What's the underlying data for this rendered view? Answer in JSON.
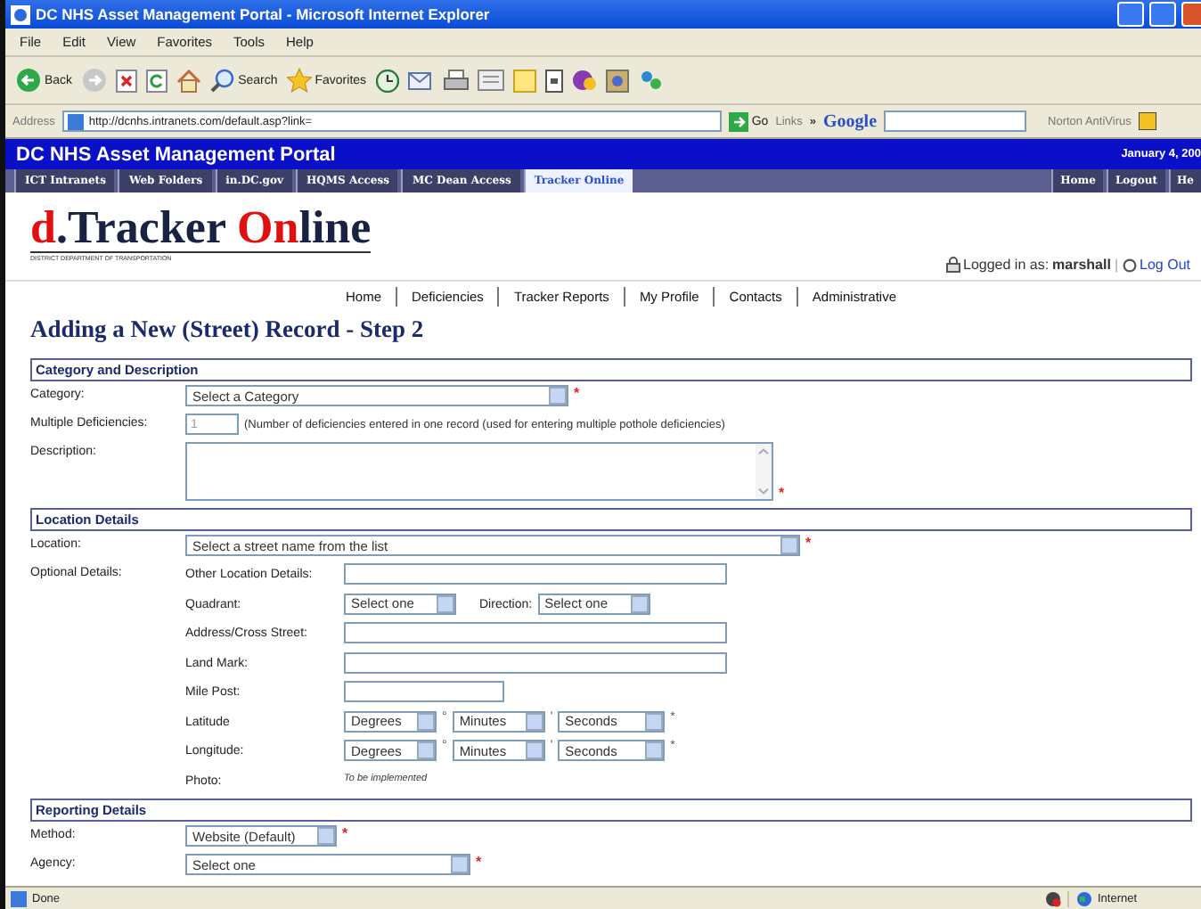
{
  "window": {
    "title": "DC NHS Asset Management Portal - Microsoft Internet Explorer"
  },
  "menu_bar": [
    "File",
    "Edit",
    "View",
    "Favorites",
    "Tools",
    "Help"
  ],
  "toolbar": [
    {
      "kind": "back",
      "label": "Back"
    },
    {
      "kind": "forward"
    },
    {
      "kind": "stop"
    },
    {
      "kind": "refresh"
    },
    {
      "kind": "home"
    },
    {
      "kind": "search",
      "label": "Search"
    },
    {
      "kind": "favorites",
      "label": "Favorites"
    },
    {
      "kind": "history"
    },
    {
      "kind": "mail"
    },
    {
      "kind": "print"
    },
    {
      "kind": "edit"
    },
    {
      "kind": "note"
    },
    {
      "kind": "phone"
    },
    {
      "kind": "messenger"
    },
    {
      "kind": "media"
    },
    {
      "kind": "people"
    }
  ],
  "address_bar": {
    "label": "Address",
    "value": "http://dcnhs.intranets.com/default.asp?link=",
    "go": "Go",
    "links": "Links",
    "links_more": "»",
    "search_brand": "Google",
    "norton": "Norton AntiVirus"
  },
  "portal": {
    "title": "DC NHS Asset Management Portal",
    "date": "January 4, 200",
    "tabs": [
      {
        "label": "ICT Intranets",
        "selected": false
      },
      {
        "label": "Web Folders",
        "selected": false
      },
      {
        "label": "in.DC.gov",
        "selected": false
      },
      {
        "label": "HQMS Access",
        "selected": false
      },
      {
        "label": "MC Dean Access",
        "selected": false
      },
      {
        "label": "Tracker Online",
        "selected": true
      }
    ],
    "right_links": [
      "Home",
      "Logout",
      "He"
    ]
  },
  "logo": {
    "parts": [
      {
        "text": "d",
        "accent": true
      },
      {
        "text": ".Tracker ",
        "accent": false
      },
      {
        "text": "On",
        "accent": true
      },
      {
        "text": "line",
        "accent": false
      }
    ],
    "tagline": "DISTRICT DEPARTMENT OF TRANSPORTATION"
  },
  "user": {
    "label": "Logged in as:",
    "name": "marshall",
    "separator": "|",
    "logout": "Log Out"
  },
  "page_menu": [
    "Home",
    "Deficiencies",
    "Tracker Reports",
    "My Profile",
    "Contacts",
    "Administrative"
  ],
  "heading": "Adding a New (Street) Record - Step 2",
  "sections": [
    {
      "title": "Category and Description",
      "rows": [
        {
          "kind": "select",
          "label": "Category:",
          "value": "Select a Category",
          "mark": "*"
        },
        {
          "kind": "number",
          "label": "Multiple Deficiencies:",
          "value": "1",
          "note": "(Number of deficiencies entered in one record (used for entering multiple pothole deficiencies)"
        },
        {
          "kind": "textarea",
          "label": "Description:",
          "mark": "*"
        }
      ]
    },
    {
      "title": "Location Details",
      "rows": [
        {
          "kind": "select",
          "label": "Location:",
          "value": "Select a street name from the list",
          "mark": "*"
        },
        {
          "kind": "group",
          "label": "Optional Details:",
          "rows": [
            {
              "kind": "text",
              "label": "Other Location Details:"
            },
            {
              "kind": "pair",
              "label": "Quadrant:",
              "value": "Select one",
              "label2": "Direction:",
              "value2": "Select one"
            },
            {
              "kind": "text",
              "label": "Address/Cross Street:"
            },
            {
              "kind": "text",
              "label": "Land Mark:"
            },
            {
              "kind": "text",
              "label": "Mile Post:"
            },
            {
              "kind": "coords",
              "label": "Latitude",
              "parts": [
                {
                  "value": "Degrees",
                  "unit": "°"
                },
                {
                  "value": "Minutes",
                  "unit": "'"
                },
                {
                  "value": "Seconds",
                  "unit": "*"
                }
              ]
            },
            {
              "kind": "coords",
              "label": "Longitude:",
              "parts": [
                {
                  "value": "Degrees",
                  "unit": "°"
                },
                {
                  "value": "Minutes",
                  "unit": "'"
                },
                {
                  "value": "Seconds",
                  "unit": "*"
                }
              ]
            },
            {
              "kind": "note",
              "label": "Photo:",
              "note": "To be implemented"
            }
          ]
        }
      ]
    },
    {
      "title": "Reporting Details",
      "rows": [
        {
          "kind": "select",
          "label": "Method:",
          "value": "Website (Default)",
          "mark": "*"
        },
        {
          "kind": "select",
          "label": "Agency:",
          "value": "Select one",
          "mark": "*"
        }
      ]
    }
  ],
  "status_bar": {
    "text": "Done",
    "zone": "Internet"
  }
}
